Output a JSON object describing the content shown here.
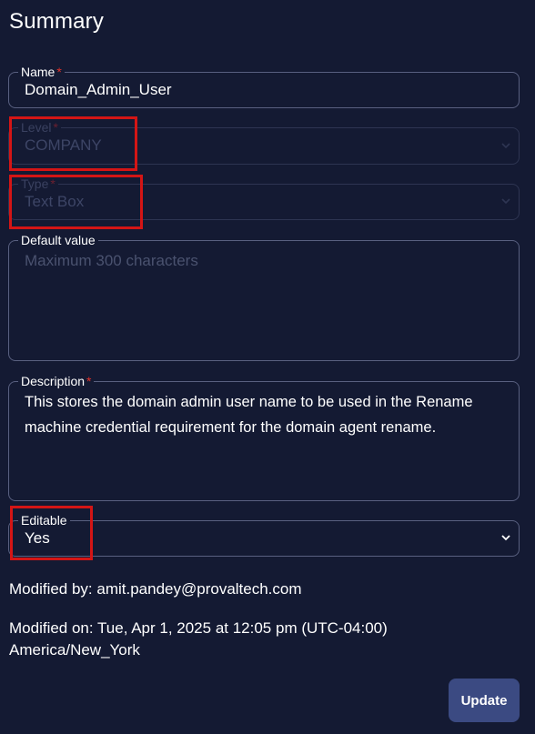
{
  "page": {
    "title": "Summary"
  },
  "form": {
    "name": {
      "label": "Name",
      "required_mark": "*",
      "value": "Domain_Admin_User"
    },
    "level": {
      "label": "Level",
      "required_mark": "*",
      "value": "COMPANY",
      "disabled": true
    },
    "type": {
      "label": "Type",
      "required_mark": "*",
      "value": "Text Box",
      "disabled": true
    },
    "default_value": {
      "label": "Default value",
      "placeholder": "Maximum 300 characters",
      "value": ""
    },
    "description": {
      "label": "Description",
      "required_mark": "*",
      "value": "This stores the domain admin user name to be used in the Rename machine credential requirement for the domain agent rename."
    },
    "editable": {
      "label": "Editable",
      "value": "Yes"
    }
  },
  "meta": {
    "modified_by": "Modified by: amit.pandey@provaltech.com",
    "modified_on_line1": "Modified on: Tue, Apr 1, 2025 at 12:05 pm (UTC-04:00)",
    "modified_on_line2": "America/New_York"
  },
  "actions": {
    "update_label": "Update"
  },
  "colors": {
    "background": "#141a33",
    "border": "#596080",
    "required": "#e0322b",
    "button": "#3b4a82",
    "highlight": "#d41515"
  },
  "icons": {
    "select_chevron": "chevron-down-icon"
  }
}
